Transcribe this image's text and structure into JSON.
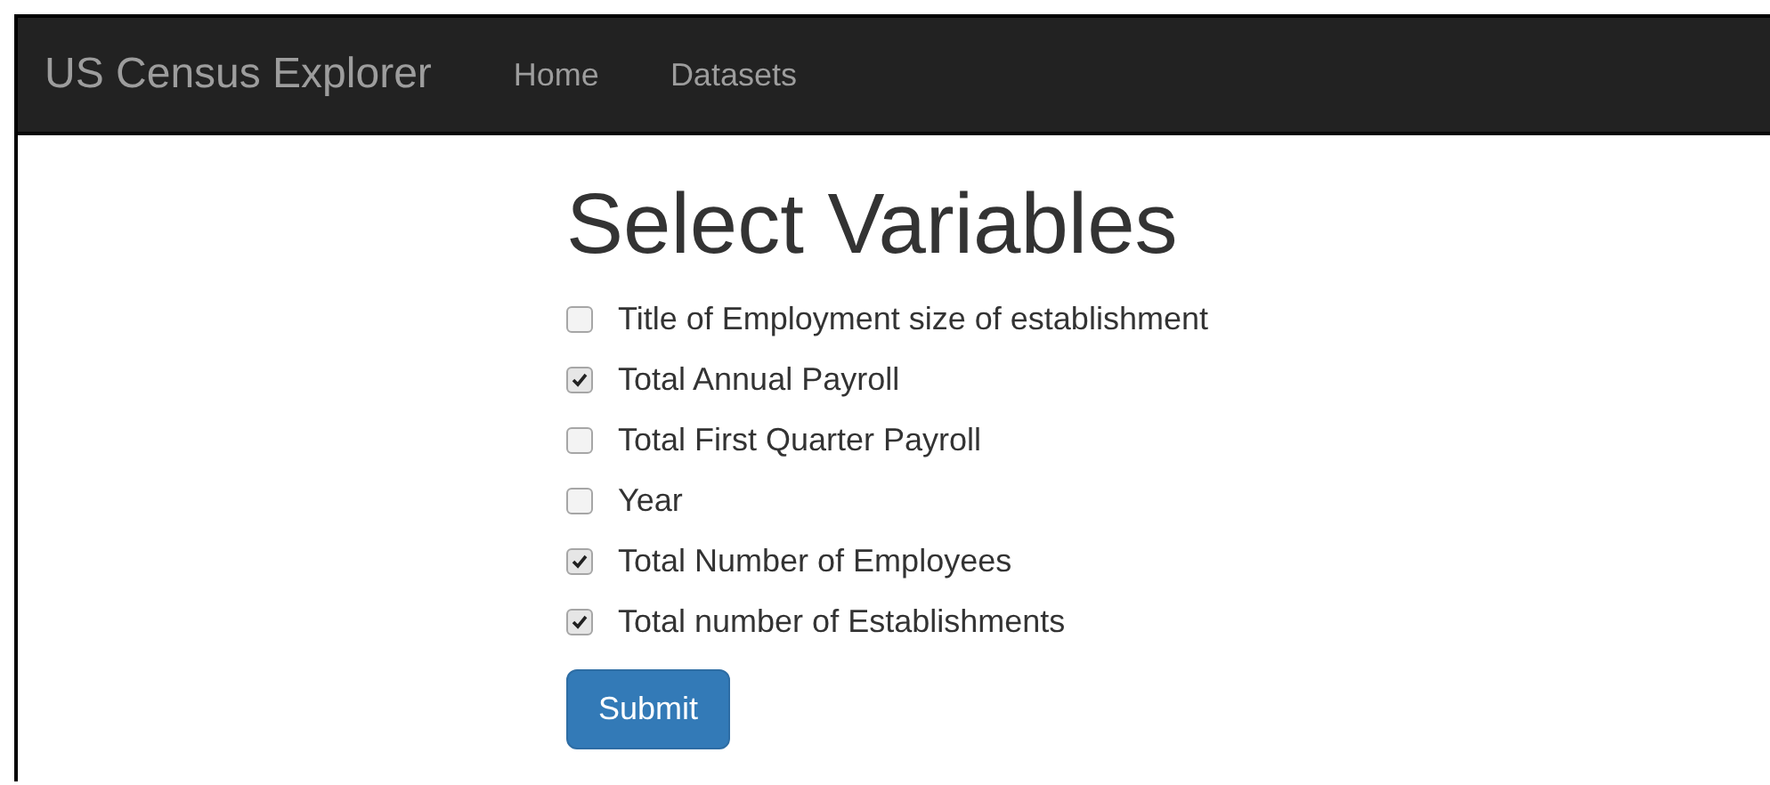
{
  "navbar": {
    "brand": "US Census Explorer",
    "links": [
      {
        "label": "Home"
      },
      {
        "label": "Datasets"
      }
    ]
  },
  "heading": "Select Variables",
  "variables": [
    {
      "label": "Title of Employment size of establishment",
      "checked": false
    },
    {
      "label": "Total Annual Payroll",
      "checked": true
    },
    {
      "label": "Total First Quarter Payroll",
      "checked": false
    },
    {
      "label": "Year",
      "checked": false
    },
    {
      "label": "Total Number of Employees",
      "checked": true
    },
    {
      "label": "Total number of Establishments",
      "checked": true
    }
  ],
  "submit": "Submit"
}
